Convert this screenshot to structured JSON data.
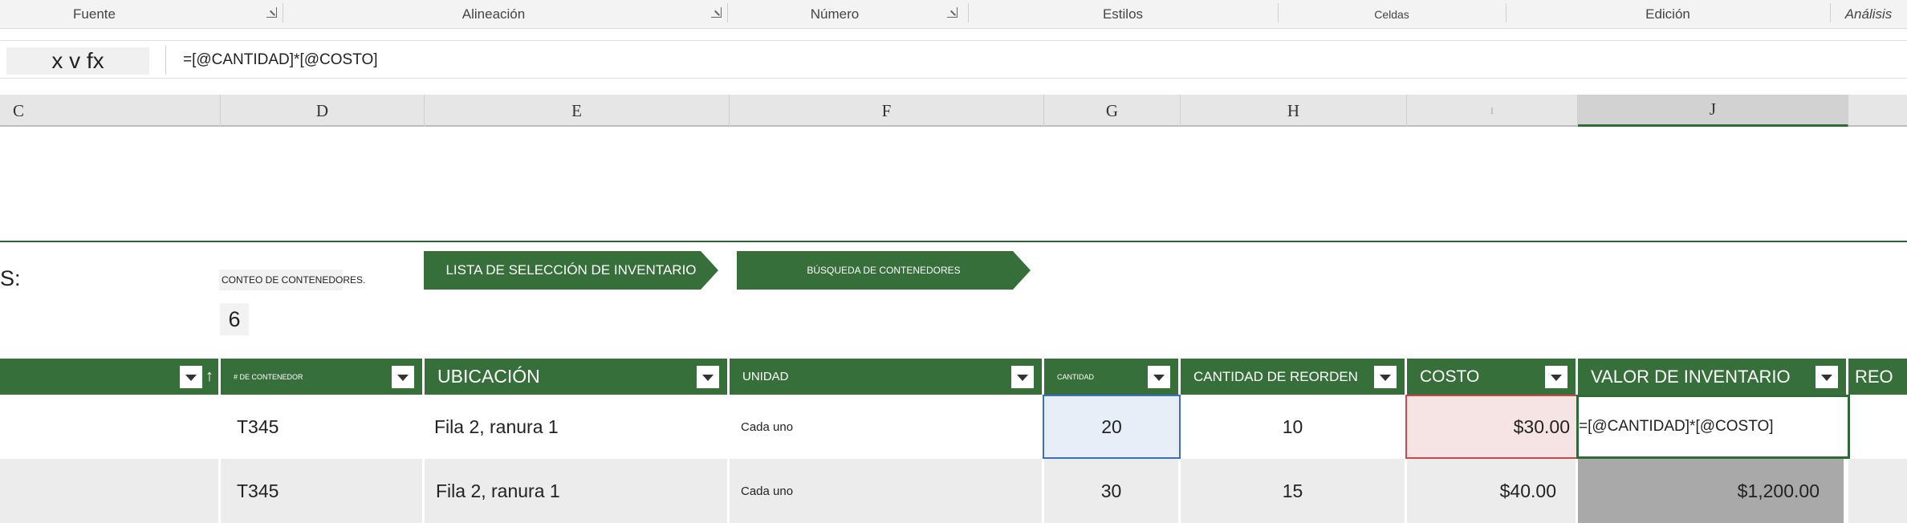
{
  "ribbon": {
    "groups": [
      "Fuente",
      "Alineación",
      "Número",
      "Estilos",
      "Celdas",
      "Edición",
      "Análisis"
    ]
  },
  "formula_bar": {
    "name_box": "x v fx",
    "formula": "=[@CANTIDAD]*[@COSTO]"
  },
  "columns": [
    "C",
    "D",
    "E",
    "F",
    "G",
    "H",
    "I",
    "J"
  ],
  "sheet": {
    "left_label": "S:",
    "bin_count_label": "CONTEO DE CONTENEDORES.",
    "bin_count_value": "6",
    "pick_list_button": "LISTA DE SELECCIÓN DE INVENTARIO",
    "bin_lookup_button": "BÚSQUEDA DE CONTENEDORES"
  },
  "table": {
    "headers": {
      "bin": "# DE CONTENEDOR",
      "location": "UBICACIÓN",
      "unit": "UNIDAD",
      "qty": "CANTIDAD",
      "reorder_qty": "CANTIDAD DE REORDEN",
      "cost": "COSTO",
      "inventory_value": "VALOR DE INVENTARIO",
      "reorder": "REO"
    },
    "rows": [
      {
        "bin": "T345",
        "location": "Fila 2, ranura 1",
        "unit": "Cada uno",
        "qty": "20",
        "reorder_qty": "10",
        "cost": "$30.00",
        "inventory_value": "=[@CANTIDAD]*[@COSTO]"
      },
      {
        "bin": "T345",
        "location": "Fila 2, ranura 1",
        "unit": "Cada uno",
        "qty": "30",
        "reorder_qty": "15",
        "cost": "$40.00",
        "inventory_value": "$1,200.00"
      }
    ]
  },
  "colors": {
    "header_green": "#376f3a",
    "qty_highlight": "#e8eef8",
    "cost_highlight": "#f6e4e4",
    "selected_gray": "#a9a9a9"
  }
}
